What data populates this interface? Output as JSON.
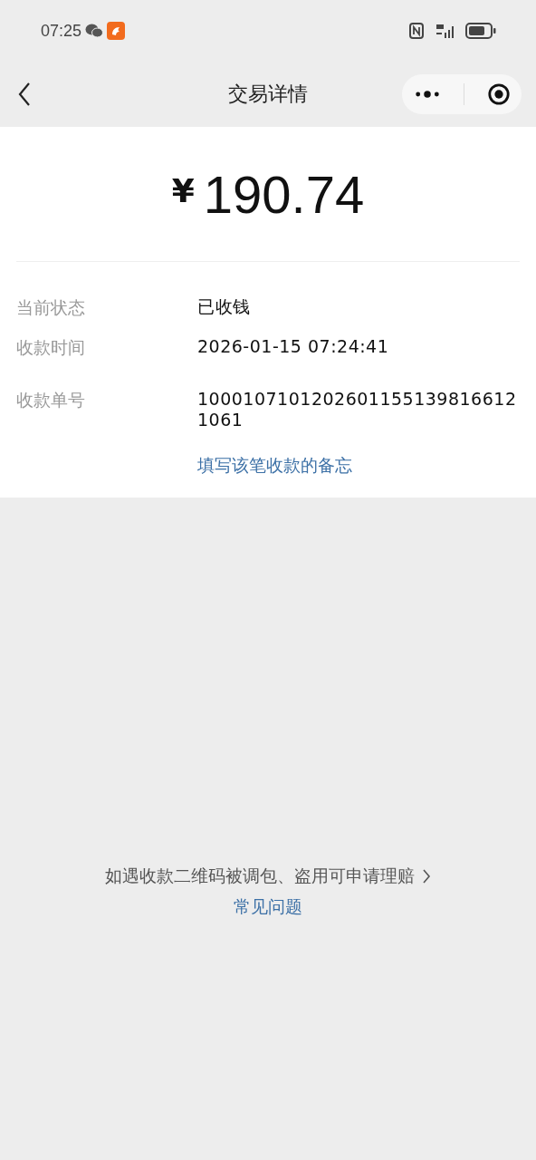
{
  "status_bar": {
    "time": "07:25"
  },
  "nav": {
    "title": "交易详情"
  },
  "amount": {
    "currency": "¥",
    "value": "190.74"
  },
  "details": [
    {
      "label": "当前状态",
      "value": "已收钱"
    },
    {
      "label": "收款时间",
      "value": "2026-01-15 07:24:41"
    },
    {
      "label": "收款单号",
      "value": "10001071012026011551398166121061"
    }
  ],
  "memo_link": "填写该笔收款的备忘",
  "footer": {
    "claim_link": "如遇收款二维码被调包、盗用可申请理赔",
    "faq_link": "常见问题"
  }
}
